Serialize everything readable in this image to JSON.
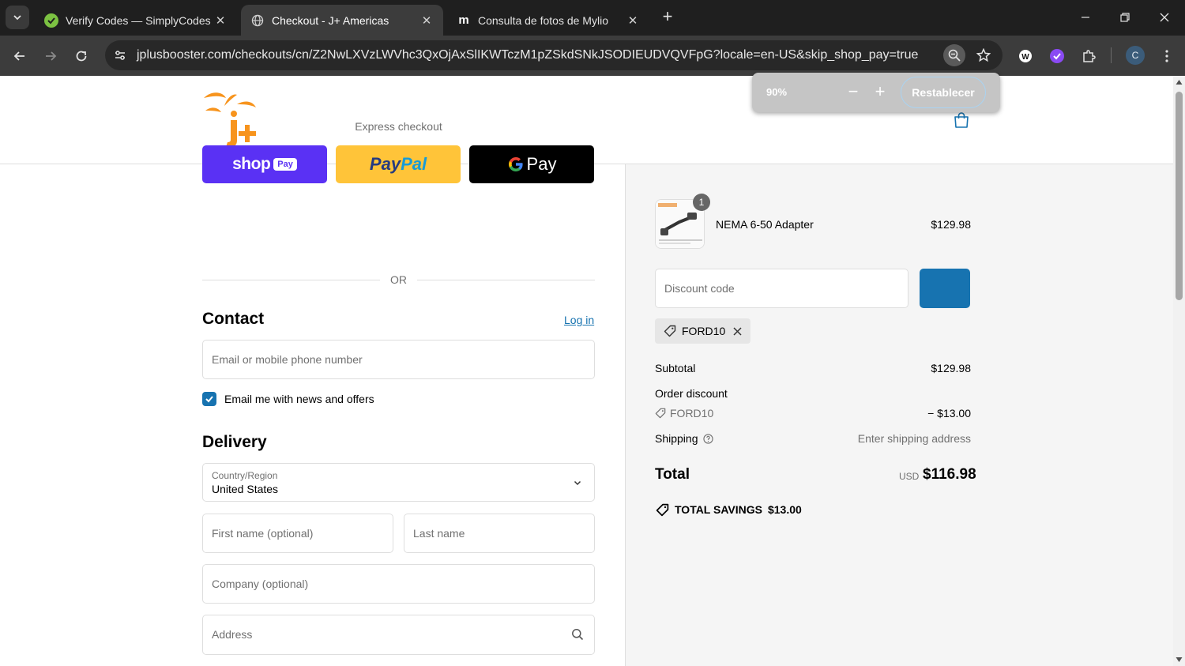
{
  "browser": {
    "tabs": [
      {
        "title": "Verify Codes — SimplyCodes",
        "active": false,
        "favicon": "simplycodes-icon"
      },
      {
        "title": "Checkout - J+ Americas",
        "active": true,
        "favicon": "globe-icon"
      },
      {
        "title": "Consulta de fotos de Mylio",
        "active": false,
        "favicon": "mylio-icon"
      }
    ],
    "url": "jplusbooster.com/checkouts/cn/Z2NwLXVzLWVhc3QxOjAxSlIKWTczM1pZSkdSNkJSODIEUDVQVFpG?locale=en-US&skip_shop_pay=true",
    "profile_initial": "C",
    "zoom_popup": {
      "percent": "90%",
      "minus": "−",
      "plus": "+",
      "reset_label": "Restablecer"
    }
  },
  "checkout": {
    "express_label": "Express checkout",
    "or_label": "OR",
    "payment_buttons": {
      "shoppay": "shop",
      "shoppay_badge": "Pay",
      "paypal_a": "Pay",
      "paypal_b": "Pal",
      "gpay": "Pay"
    },
    "contact": {
      "heading": "Contact",
      "login_label": "Log in",
      "email_placeholder": "Email or mobile phone number",
      "newsletter_label": "Email me with news and offers",
      "newsletter_checked": true
    },
    "delivery": {
      "heading": "Delivery",
      "country_label": "Country/Region",
      "country_value": "United States",
      "first_name_placeholder": "First name (optional)",
      "last_name_placeholder": "Last name",
      "company_placeholder": "Company (optional)",
      "address_placeholder": "Address"
    }
  },
  "summary": {
    "product": {
      "name": "NEMA 6-50 Adapter",
      "price": "$129.98",
      "quantity": "1"
    },
    "discount_placeholder": "Discount code",
    "applied_code": "FORD10",
    "subtotal_label": "Subtotal",
    "subtotal_value": "$129.98",
    "order_discount_label": "Order discount",
    "discount_code": "FORD10",
    "discount_value": "− $13.00",
    "shipping_label": "Shipping",
    "shipping_value": "Enter shipping address",
    "total_label": "Total",
    "total_currency": "USD",
    "total_value": "$116.98",
    "savings_label": "TOTAL SAVINGS",
    "savings_value": "$13.00"
  },
  "colors": {
    "accent": "#1773b0",
    "shoppay": "#5a31f4",
    "paypal": "#ffc439",
    "logo": "#f7941d"
  }
}
